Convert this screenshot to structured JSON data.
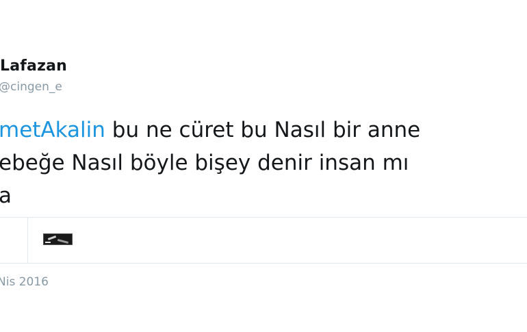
{
  "tweet": {
    "display_name": "Lafazan",
    "handle": "@cingen_e",
    "mention": "metAkalin",
    "line1_rest": " bu ne cüret bu Nasıl bir anne",
    "line2": "ebeğe Nasıl böyle bişey denir insan mı",
    "line3": "a",
    "date": "Nis 2016"
  },
  "media": {
    "thumbnail_icon": "photo-thumbnail-icon"
  },
  "colors": {
    "mention": "#1b95e0",
    "text": "#14171a",
    "muted": "#8899a6",
    "divider": "#e1e8ed"
  }
}
